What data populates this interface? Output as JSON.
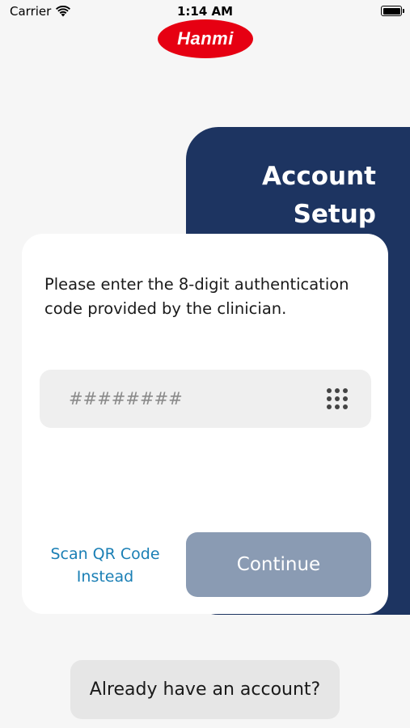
{
  "status_bar": {
    "carrier": "Carrier",
    "time": "1:14 AM",
    "wifi_icon": "wifi-icon",
    "battery_icon": "battery-icon"
  },
  "logo": {
    "text": "Hanmi",
    "color": "#e60012"
  },
  "setup_panel": {
    "title_line1": "Account",
    "title_line2": "Setup",
    "color": "#1d3461"
  },
  "card": {
    "instructions": "Please enter the 8-digit authentication code provided by the clinician.",
    "code_field": {
      "placeholder": "########",
      "value": "",
      "icon": "keypad-icon"
    },
    "scan_link_line1": "Scan QR Code",
    "scan_link_line2": "Instead",
    "continue_label": "Continue",
    "continue_color": "#8a9bb3",
    "link_color": "#1a7fb5"
  },
  "footer": {
    "account_button_label": "Already have an account?"
  }
}
